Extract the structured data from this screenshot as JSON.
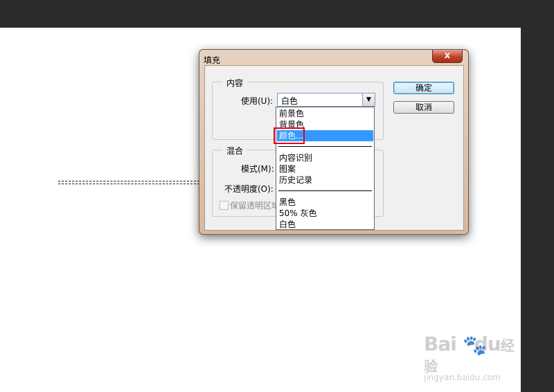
{
  "dialog": {
    "title": "填充",
    "close_label": "x",
    "content_group": {
      "label": "内容",
      "use_label": "使用(U):",
      "use_value": "白色"
    },
    "blend_group": {
      "label": "混合",
      "mode_label": "模式(M):",
      "opacity_label": "不透明度(O):",
      "preserve_label": "保留透明区域"
    },
    "ok_label": "确定",
    "cancel_label": "取消"
  },
  "dropdown": {
    "items": [
      "前景色",
      "背景色",
      "颜色...",
      "内容识别",
      "图案",
      "历史记录",
      "黑色",
      "50% 灰色",
      "白色"
    ],
    "selected": "颜色..."
  },
  "watermark": {
    "logo": "Bai",
    "logo2": "du",
    "logo3": "经验",
    "url": "jingyan.baidu.com"
  }
}
